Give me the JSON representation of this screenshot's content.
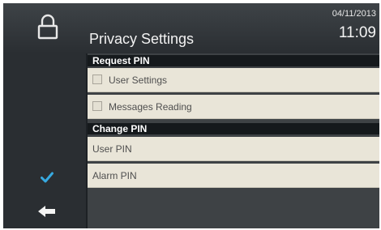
{
  "header": {
    "title": "Privacy Settings",
    "date": "04/11/2013",
    "time": "11:09",
    "lock_icon": "lock-icon"
  },
  "sidebar": {
    "confirm_icon": "checkmark-icon",
    "back_icon": "back-arrow-icon"
  },
  "sections": {
    "request_pin": {
      "label": "Request PIN",
      "items": [
        {
          "label": "User Settings",
          "checked": false
        },
        {
          "label": "Messages Reading",
          "checked": false
        }
      ]
    },
    "change_pin": {
      "label": "Change PIN",
      "items": [
        {
          "label": "User PIN"
        },
        {
          "label": "Alarm PIN"
        }
      ]
    }
  },
  "colors": {
    "accent": "#37a9e0",
    "row_background": "#e9e5d8",
    "section_header": "#15191c"
  }
}
